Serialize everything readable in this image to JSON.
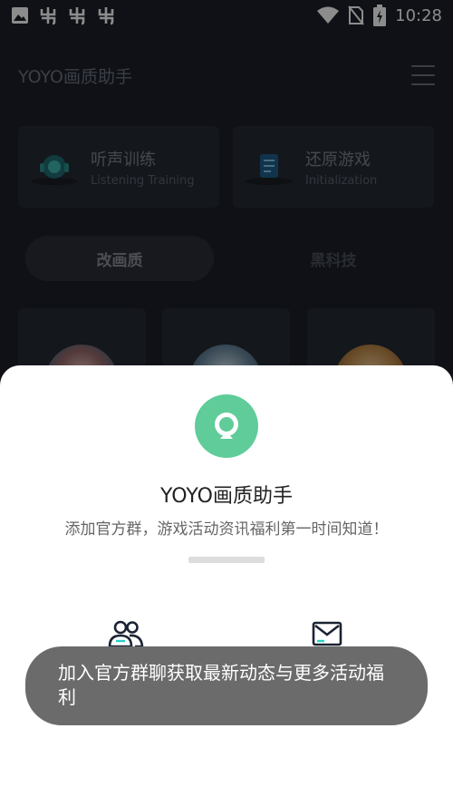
{
  "status_bar": {
    "time": "10:28",
    "left_icons": [
      "image-icon",
      "bug-icon",
      "bug-icon",
      "bug-icon"
    ],
    "right_icons": [
      "wifi-icon",
      "no-sim-icon",
      "battery-charging-icon"
    ]
  },
  "header": {
    "title": "YOYO画质助手",
    "menu_icon": "menu-icon"
  },
  "features": [
    {
      "title": "听声训练",
      "subtitle": "Listening Training",
      "icon": "headset-icon"
    },
    {
      "title": "还原游戏",
      "subtitle": "Initialization",
      "icon": "restore-icon"
    }
  ],
  "tabs": [
    {
      "label": "改画质",
      "active": true
    },
    {
      "label": "黑科技",
      "active": false
    }
  ],
  "sheet": {
    "title": "YOYO画质助手",
    "description": "添加官方群，游戏活动资讯福利第一时间知道！",
    "actions": [
      {
        "icon": "group-icon"
      },
      {
        "icon": "mail-icon"
      }
    ]
  },
  "toast": {
    "message": "加入官方群聊获取最新动态与更多活动福利"
  },
  "colors": {
    "background": "#1c2029",
    "accent": "#5fcc99",
    "toast": "#6b6b6b"
  }
}
